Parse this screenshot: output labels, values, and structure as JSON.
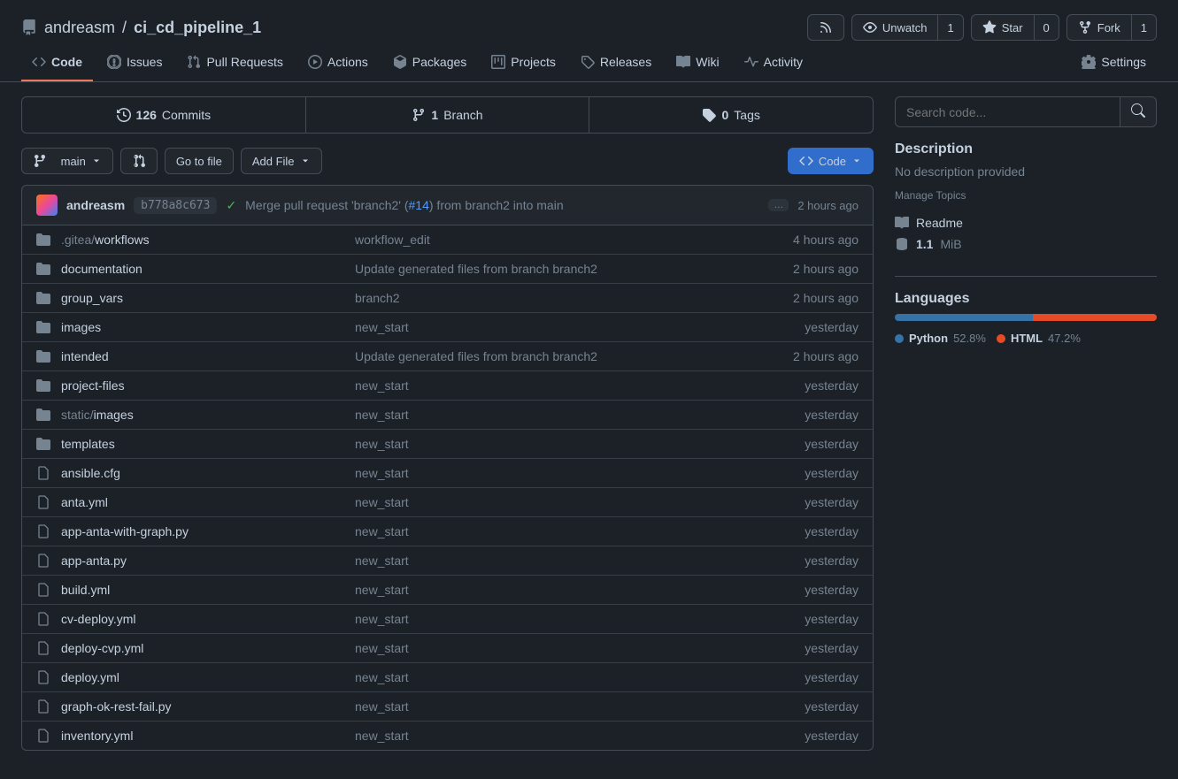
{
  "breadcrumb": {
    "owner": "andreasm",
    "sep": "/",
    "repo": "ci_cd_pipeline_1"
  },
  "headerActions": {
    "unwatch": {
      "label": "Unwatch",
      "count": "1"
    },
    "star": {
      "label": "Star",
      "count": "0"
    },
    "fork": {
      "label": "Fork",
      "count": "1"
    }
  },
  "tabs": {
    "code": "Code",
    "issues": "Issues",
    "pulls": "Pull Requests",
    "actions": "Actions",
    "packages": "Packages",
    "projects": "Projects",
    "releases": "Releases",
    "wiki": "Wiki",
    "activity": "Activity",
    "settings": "Settings"
  },
  "stats": {
    "commits": {
      "num": "126",
      "label": "Commits"
    },
    "branches": {
      "num": "1",
      "label": "Branch"
    },
    "tags": {
      "num": "0",
      "label": "Tags"
    }
  },
  "toolbar": {
    "branch": "main",
    "goToFile": "Go to file",
    "addFile": "Add File",
    "code": "Code"
  },
  "commit": {
    "author": "andreasm",
    "sha": "b778a8c673",
    "msgPrefix": "Merge pull request 'branch2' (",
    "pr": "#14",
    "msgSuffix": ") from branch2 into main",
    "ellipsis": "…",
    "time": "2 hours ago"
  },
  "files": [
    {
      "type": "folder",
      "nameMuted": ".gitea",
      "nameSep": "/",
      "name": "workflows",
      "msg": "workflow_edit",
      "time": "4 hours ago"
    },
    {
      "type": "folder",
      "name": "documentation",
      "msg": "Update generated files from branch branch2",
      "time": "2 hours ago"
    },
    {
      "type": "folder",
      "name": "group_vars",
      "msg": "branch2",
      "time": "2 hours ago"
    },
    {
      "type": "folder",
      "name": "images",
      "msg": "new_start",
      "time": "yesterday"
    },
    {
      "type": "folder",
      "name": "intended",
      "msg": "Update generated files from branch branch2",
      "time": "2 hours ago"
    },
    {
      "type": "folder",
      "name": "project-files",
      "msg": "new_start",
      "time": "yesterday"
    },
    {
      "type": "folder",
      "nameMuted": "static",
      "nameSep": "/",
      "name": "images",
      "msg": "new_start",
      "time": "yesterday"
    },
    {
      "type": "folder",
      "name": "templates",
      "msg": "new_start",
      "time": "yesterday"
    },
    {
      "type": "file",
      "name": "ansible.cfg",
      "msg": "new_start",
      "time": "yesterday"
    },
    {
      "type": "file",
      "name": "anta.yml",
      "msg": "new_start",
      "time": "yesterday"
    },
    {
      "type": "file",
      "name": "app-anta-with-graph.py",
      "msg": "new_start",
      "time": "yesterday"
    },
    {
      "type": "file",
      "name": "app-anta.py",
      "msg": "new_start",
      "time": "yesterday"
    },
    {
      "type": "file",
      "name": "build.yml",
      "msg": "new_start",
      "time": "yesterday"
    },
    {
      "type": "file",
      "name": "cv-deploy.yml",
      "msg": "new_start",
      "time": "yesterday"
    },
    {
      "type": "file",
      "name": "deploy-cvp.yml",
      "msg": "new_start",
      "time": "yesterday"
    },
    {
      "type": "file",
      "name": "deploy.yml",
      "msg": "new_start",
      "time": "yesterday"
    },
    {
      "type": "file",
      "name": "graph-ok-rest-fail.py",
      "msg": "new_start",
      "time": "yesterday"
    },
    {
      "type": "file",
      "name": "inventory.yml",
      "msg": "new_start",
      "time": "yesterday"
    }
  ],
  "sidebar": {
    "search": {
      "placeholder": "Search code..."
    },
    "descTitle": "Description",
    "descText": "No description provided",
    "manageTopics": "Manage Topics",
    "readme": "Readme",
    "size": "1.1",
    "sizeUnit": "MiB",
    "langTitle": "Languages",
    "languages": [
      {
        "name": "Python",
        "pct": "52.8%",
        "color": "#3572A5"
      },
      {
        "name": "HTML",
        "pct": "47.2%",
        "color": "#e34c26"
      }
    ]
  }
}
